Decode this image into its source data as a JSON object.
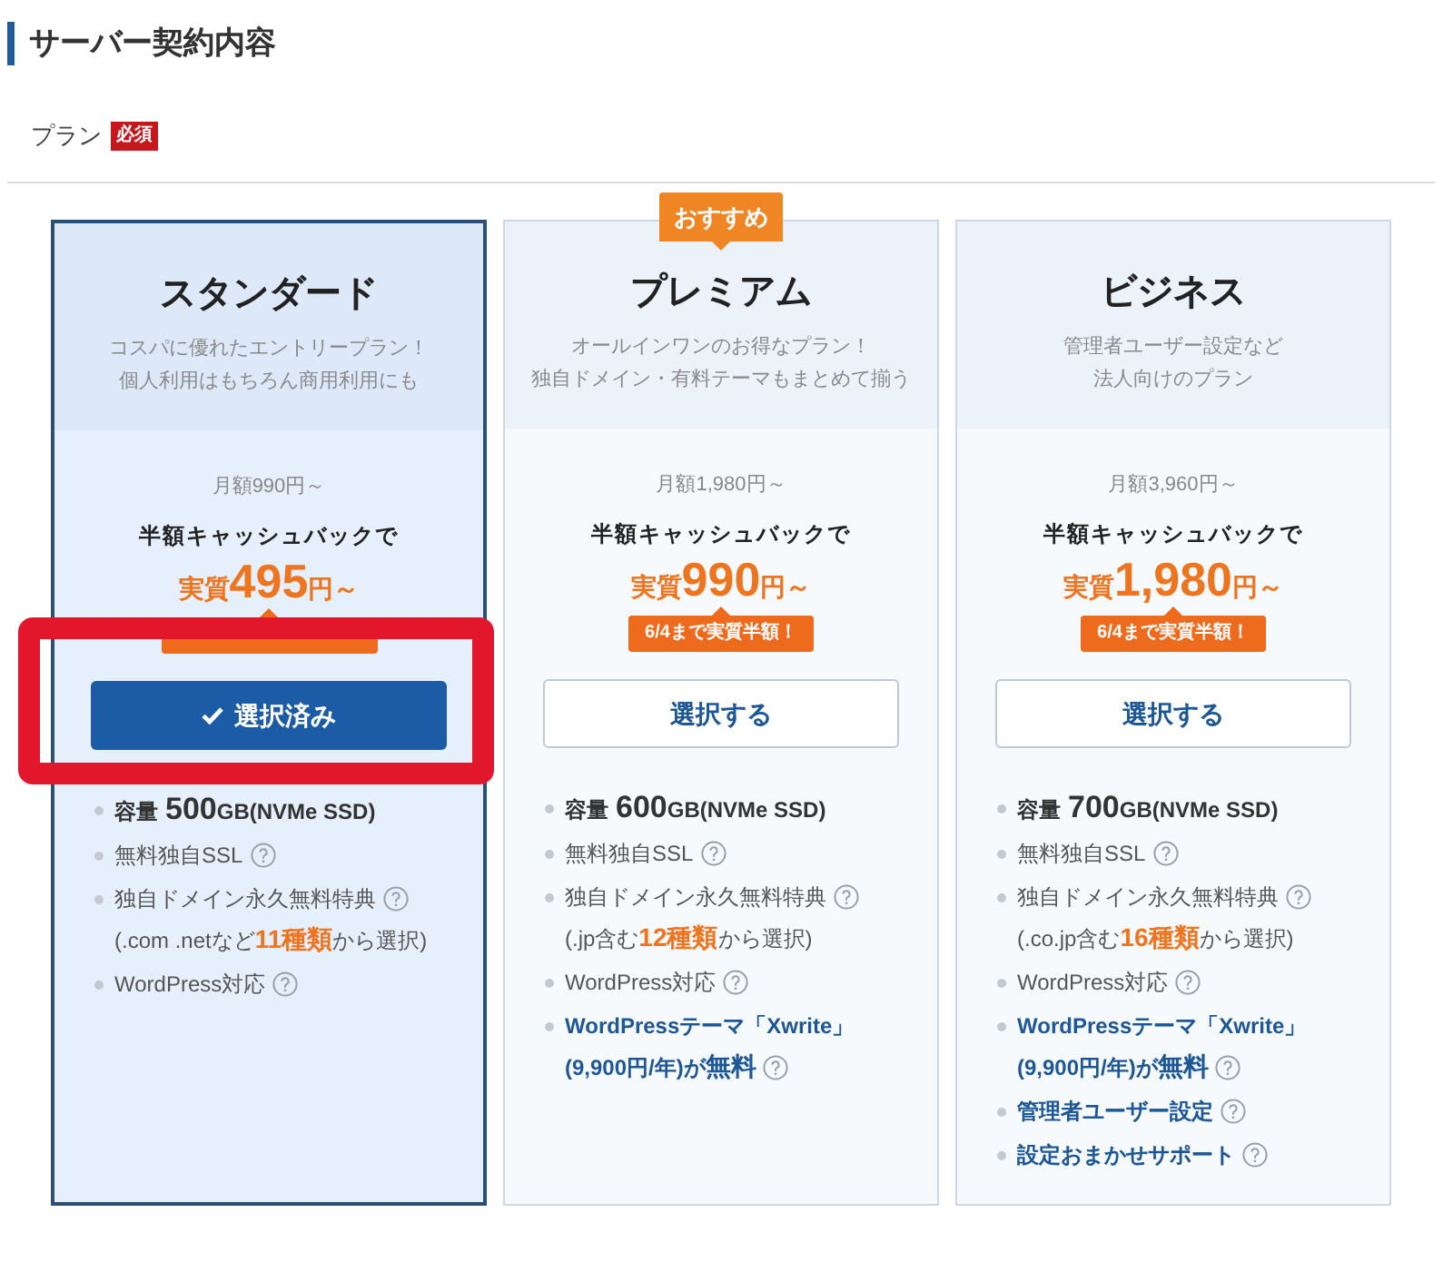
{
  "section": {
    "title": "サーバー契約内容"
  },
  "field": {
    "label": "プラン",
    "required_badge": "必須"
  },
  "plans": [
    {
      "name": "スタンダード",
      "selected": true,
      "highlighted": true,
      "description": [
        "コスパに優れたエントリープラン！",
        "個人利用はもちろん商用利用にも"
      ],
      "monthly": "月額990円～",
      "cashback": "半額キャッシュバックで",
      "price": {
        "prefix": "実質",
        "amount": "495",
        "suffix": "円～"
      },
      "badge": {
        "covered": true
      },
      "button": "選択済み",
      "features": [
        {
          "kind": "capacity",
          "label": "容量",
          "amount": "500",
          "unit": "GB(NVMe SSD)"
        },
        {
          "kind": "plain",
          "lines": [
            {
              "text": "無料独自SSL",
              "help": true
            }
          ]
        },
        {
          "kind": "plain",
          "lines": [
            {
              "text": "独自ドメイン永久無料特典",
              "help": true
            },
            {
              "text": "(.com .netなど**11種類**から選択)",
              "help": false
            }
          ]
        },
        {
          "kind": "plain",
          "lines": [
            {
              "text": "WordPress対応",
              "help": true
            }
          ]
        }
      ]
    },
    {
      "name": "プレミアム",
      "ribbon": "おすすめ",
      "selected": false,
      "highlighted": false,
      "description": [
        "オールインワンのお得なプラン！",
        "独自ドメイン・有料テーマもまとめて揃う"
      ],
      "monthly": "月額1,980円～",
      "cashback": "半額キャッシュバックで",
      "price": {
        "prefix": "実質",
        "amount": "990",
        "suffix": "円～"
      },
      "badge": {
        "covered": false,
        "text": "6/4まで実質半額！"
      },
      "button": "選択する",
      "features": [
        {
          "kind": "capacity",
          "label": "容量",
          "amount": "600",
          "unit": "GB(NVMe SSD)"
        },
        {
          "kind": "plain",
          "lines": [
            {
              "text": "無料独自SSL",
              "help": true
            }
          ]
        },
        {
          "kind": "plain",
          "lines": [
            {
              "text": "独自ドメイン永久無料特典",
              "help": true
            },
            {
              "text": "(.jp含む**12種類**から選択)",
              "help": false
            }
          ]
        },
        {
          "kind": "plain",
          "lines": [
            {
              "text": "WordPress対応",
              "help": true
            }
          ]
        },
        {
          "kind": "emphasis",
          "lines": [
            {
              "text": "WordPressテーマ「Xwrite」",
              "help": false
            },
            {
              "text": "(9,900円/年)が**無料**",
              "help": true
            }
          ]
        }
      ]
    },
    {
      "name": "ビジネス",
      "selected": false,
      "highlighted": false,
      "description": [
        "管理者ユーザー設定など",
        "法人向けのプラン"
      ],
      "monthly": "月額3,960円～",
      "cashback": "半額キャッシュバックで",
      "price": {
        "prefix": "実質",
        "amount": "1,980",
        "suffix": "円～"
      },
      "badge": {
        "covered": false,
        "text": "6/4まで実質半額！"
      },
      "button": "選択する",
      "features": [
        {
          "kind": "capacity",
          "label": "容量",
          "amount": "700",
          "unit": "GB(NVMe SSD)"
        },
        {
          "kind": "plain",
          "lines": [
            {
              "text": "無料独自SSL",
              "help": true
            }
          ]
        },
        {
          "kind": "plain",
          "lines": [
            {
              "text": "独自ドメイン永久無料特典",
              "help": true
            },
            {
              "text": "(.co.jp含む**16種類**から選択)",
              "help": false
            }
          ]
        },
        {
          "kind": "plain",
          "lines": [
            {
              "text": "WordPress対応",
              "help": true
            }
          ]
        },
        {
          "kind": "emphasis",
          "lines": [
            {
              "text": "WordPressテーマ「Xwrite」",
              "help": false
            },
            {
              "text": "(9,900円/年)が**無料**",
              "help": true
            }
          ]
        },
        {
          "kind": "emphasis",
          "lines": [
            {
              "text": "管理者ユーザー設定",
              "help": true
            }
          ]
        },
        {
          "kind": "emphasis",
          "lines": [
            {
              "text": "設定おまかせサポート",
              "help": true
            }
          ]
        }
      ]
    }
  ]
}
